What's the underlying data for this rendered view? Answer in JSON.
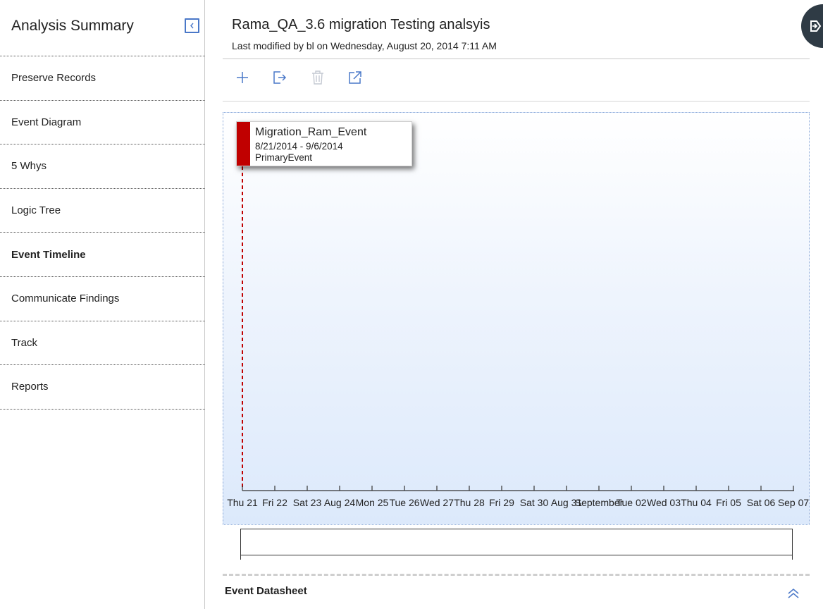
{
  "sidebar": {
    "title": "Analysis Summary",
    "collapse_icon": "chevron-left-icon",
    "items": [
      {
        "label": "Preserve Records",
        "active": false
      },
      {
        "label": "Event Diagram",
        "active": false
      },
      {
        "label": "5 Whys",
        "active": false
      },
      {
        "label": "Logic Tree",
        "active": false
      },
      {
        "label": "Event Timeline",
        "active": true
      },
      {
        "label": "Communicate Findings",
        "active": false
      },
      {
        "label": "Track",
        "active": false
      },
      {
        "label": "Reports",
        "active": false
      }
    ]
  },
  "header": {
    "title": "Rama_QA_3.6 migration Testing analsyis",
    "subtitle": "Last modified by bl on Wednesday, August 20, 2014 7:11 AM"
  },
  "toolbar": {
    "icons": [
      "plus-icon",
      "export-icon",
      "trash-icon",
      "external-link-icon"
    ],
    "accent": "#4a78c8",
    "disabled_color": "#c4c9d2"
  },
  "timeline": {
    "event": {
      "name": "Migration_Ram_Event",
      "dates": "8/21/2014 - 9/6/2014",
      "type": "PrimaryEvent",
      "color": "#c00000"
    },
    "ticks": [
      "Thu 21",
      "Fri 22",
      "Sat 23",
      "Aug 24",
      "Mon 25",
      "Tue 26",
      "Wed 27",
      "Thu 28",
      "Fri 29",
      "Sat 30",
      "Aug 31",
      "September",
      "Tue 02",
      "Wed 03",
      "Thu 04",
      "Fri 05",
      "Sat 06",
      "Sep 07"
    ]
  },
  "datasheet": {
    "label": "Event Datasheet",
    "toggle_icon": "double-chevron-up-icon"
  }
}
